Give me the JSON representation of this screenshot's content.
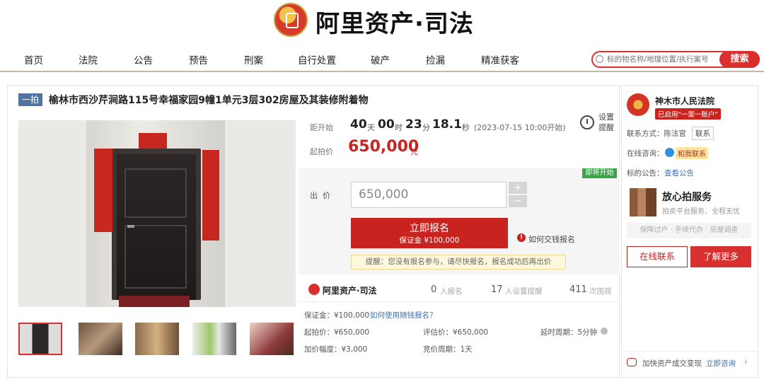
{
  "header": {
    "logo_text": "阿里资产·司法"
  },
  "nav": {
    "items": [
      "首页",
      "法院",
      "公告",
      "预告",
      "刑案",
      "自行处置",
      "破产",
      "捡漏",
      "精准获客"
    ]
  },
  "search": {
    "placeholder": "标的物名称/地理位置/执行案号",
    "button_label": "搜索"
  },
  "listing": {
    "badge": "一拍",
    "title": "榆林市西沙芹涧路115号幸福家园9幢1单元3层302房屋及其装修附着物"
  },
  "countdown": {
    "label": "距开始",
    "days": "40",
    "days_unit": "天",
    "hours": "00",
    "hours_unit": "时",
    "minutes": "23",
    "minutes_unit": "分",
    "seconds": "18.1",
    "seconds_unit": "秒",
    "start_note": "(2023-07-15 10:00开始)",
    "reminder_label_1": "设置",
    "reminder_label_2": "提醒"
  },
  "start_price": {
    "label": "起拍价",
    "value": "650,000",
    "unit": "元"
  },
  "bid": {
    "status_tag": "即将开始",
    "label": "出  价",
    "value": "650,000",
    "plus": "+",
    "minus": "−",
    "signup_label": "立即报名",
    "deposit_label": "保证金 ¥100,000",
    "how_to_pay": "如何交钱报名",
    "reminder_text": "提醒：您没有报名参与，请尽快报名，报名成功后再出价"
  },
  "stats": {
    "brand": "阿里资产·司法",
    "signups_num": "0",
    "signups_label": "人报名",
    "reminders_num": "17",
    "reminders_label": "人设置提醒",
    "views_num": "411",
    "views_label": "次围观"
  },
  "details": {
    "deposit": "保证金：¥100,000",
    "deposit_help": "如何使用随钱报名？",
    "start_price": "起拍价：¥650,000",
    "appraisal": "评估价：¥650,000",
    "delay": "延时周期：5分钟",
    "increment": "加价幅度：¥3,000",
    "auction_period": "竞价周期：1天"
  },
  "side": {
    "court_name": "神木市人民法院",
    "court_tag": "已启用\"一案一账户\"",
    "contact_label": "联系方式：陈法官",
    "contact_btn": "联系",
    "consult_label": "在线咨询：",
    "consult_btn": "和我联系",
    "notice_label": "标的公告：",
    "notice_link": "查看公告",
    "service_title": "放心拍服务",
    "service_desc": "拍卖平台服务、全程无忧",
    "service_feats": "保障过户 · 手续代办 · 房屋调查",
    "btn_contact": "在线联系",
    "btn_more": "了解更多",
    "promo_text": "加快资产成交变现",
    "promo_link": "立即咨询"
  },
  "colors": {
    "brand_red": "#d9302f",
    "price_red": "#c9231f",
    "badge_blue": "#5273a0",
    "status_green": "#3aa44a"
  }
}
